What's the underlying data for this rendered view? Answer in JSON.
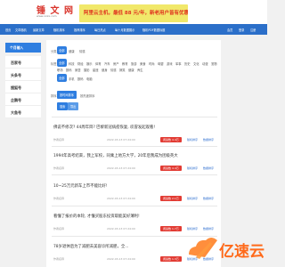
{
  "header": {
    "logo_text": "锤 文 网",
    "logo_url": "www.xxxx.com",
    "banner_text": "阿里云主机，最低 88 元/年，新老用户皆有优惠!",
    "banner_color": "#f1e86a"
  },
  "nav": {
    "items": [
      "首页",
      "文章随机",
      "最新文章",
      "随机排序",
      "推荐排序",
      "每日热点",
      "每十月数据展示",
      "随机PDF数据标题"
    ],
    "right": [
      "会员",
      "登录",
      "注册"
    ]
  },
  "sidebar": {
    "head": "个月输入",
    "entries": [
      "百家号",
      "头条号",
      "搜狐号",
      "企鹅号",
      "大鱼号"
    ]
  },
  "filters": {
    "row1_label": "分类:",
    "row1": [
      "全部",
      "健康",
      "情感"
    ],
    "row2_label": "标签:",
    "row2": [
      "全部",
      "科技",
      "财经",
      "娱乐",
      "体育",
      "汽车",
      "房产",
      "教育",
      "旅游",
      "美食",
      "时尚",
      "母婴",
      "游戏",
      "军事",
      "历史",
      "文化",
      "动漫",
      "宠物",
      "职场",
      "数码",
      "家居",
      "摄影",
      "星座",
      "健身",
      "情感",
      "搞笑",
      "健康",
      "养生"
    ],
    "row3": [
      "全部",
      "手机",
      "数码",
      "电脑"
    ],
    "row4_label": "排序:",
    "row4_active": "按时间排序",
    "row4_other": "按热度排序",
    "search_button": "搜索",
    "export_button": "导出"
  },
  "articles": [
    {
      "title": "佛说不修次? 44周年目? 巴黎新冠病疫恢复, 叹冒发起观看!",
      "author": "作者名称",
      "date": "2022-03-13 07:24:00",
      "badge": "阅读数 4.4万",
      "link1": "随机排序",
      "link2": "数据排序"
    },
    {
      "title": "1994年高考结束，我上军校，同乘上地方大学，20年后我成为团级英大",
      "author": "作者名称",
      "date": "2022-03-13 07:24:00",
      "badge": "阅读数 4.4万",
      "link1": "随机排序",
      "link2": "数据排序"
    },
    {
      "title": "10~25万元新车上市不能比好!",
      "author": "作者名称",
      "date": "2022-03-13 07:24:00",
      "badge": "阅读数 2.1万",
      "link1": "随机排序",
      "link2": "数据排序"
    },
    {
      "title": "看懂了报价的本轮, 才懂买股东投资取能美好薄利!",
      "author": "作者名称",
      "date": "2022-03-13 07:24:00",
      "badge": "阅读数 1.7万",
      "link1": "随机排序",
      "link2": "数据排序"
    },
    {
      "title": "78岁退休后为了减肥去美容诊所减肥，全...",
      "author": "作者名称",
      "date": "2022-03-13 07:24:00",
      "badge": "阅读数 1.3万",
      "link1": "随机排序",
      "link2": "数据排序"
    }
  ],
  "watermark": "亿速云"
}
